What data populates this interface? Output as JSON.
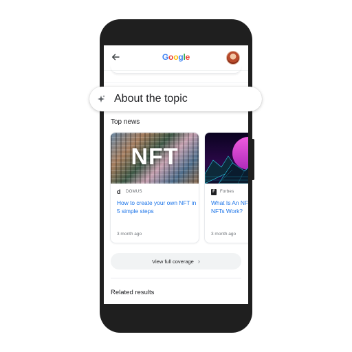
{
  "topbar": {
    "back_icon": "arrow-back-icon",
    "logo_letters": [
      {
        "char": "G",
        "color": "#4285F4"
      },
      {
        "char": "o",
        "color": "#EA4335"
      },
      {
        "char": "o",
        "color": "#FBBC05"
      },
      {
        "char": "g",
        "color": "#4285F4"
      },
      {
        "char": "l",
        "color": "#34A853"
      },
      {
        "char": "e",
        "color": "#EA4335"
      }
    ],
    "avatar": "profile-avatar"
  },
  "search_pill": {
    "icon": "sparkle-icon",
    "text": "About the topic"
  },
  "top_news": {
    "label": "Top news",
    "cards": [
      {
        "image_text": "NFT",
        "source_name": "DOMUS",
        "source_logo": "d",
        "headline": "How to create your own NFT in 5 simple steps",
        "time": "3 month ago"
      },
      {
        "image_text": "",
        "source_name": "Forbes",
        "source_logo": "F",
        "headline": "What Is An NFT and How Do NFTs Work?",
        "time": "3 month ago"
      }
    ]
  },
  "coverage_button": {
    "label": "View full coverage",
    "icon": "chevron-right-icon"
  },
  "related": {
    "label": "Related results"
  },
  "colors": {
    "link": "#1a73e8",
    "phone_frame": "#1f1f1f",
    "chip_bg": "#f1f3f4"
  }
}
